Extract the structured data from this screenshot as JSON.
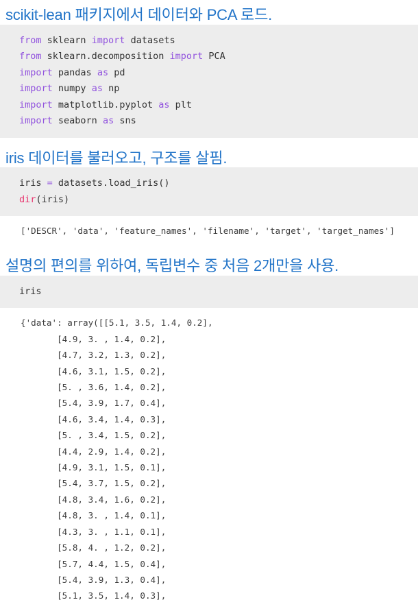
{
  "document": {
    "theme": {
      "page_background": "#ffffff",
      "heading_color": "#2274c8",
      "code_background": "#ededed",
      "code_text": "#333333",
      "keyword_color": "#9254de",
      "function_color": "#e8366f",
      "output_text": "#3c3c3c"
    },
    "cells": [
      {
        "type": "heading",
        "text": "scikit-lean 패키지에서 데이터와 PCA 로드."
      },
      {
        "type": "code",
        "lines": [
          [
            {
              "t": "from",
              "c": "kw"
            },
            {
              "t": " sklearn "
            },
            {
              "t": "import",
              "c": "kw"
            },
            {
              "t": " datasets"
            }
          ],
          [
            {
              "t": "from",
              "c": "kw"
            },
            {
              "t": " sklearn.decomposition "
            },
            {
              "t": "import",
              "c": "kw"
            },
            {
              "t": " PCA"
            }
          ],
          [
            {
              "t": "import",
              "c": "kw"
            },
            {
              "t": " pandas "
            },
            {
              "t": "as",
              "c": "kw"
            },
            {
              "t": " pd"
            }
          ],
          [
            {
              "t": "import",
              "c": "kw"
            },
            {
              "t": " numpy "
            },
            {
              "t": "as",
              "c": "kw"
            },
            {
              "t": " np"
            }
          ],
          [
            {
              "t": "import",
              "c": "kw"
            },
            {
              "t": " matplotlib.pyplot "
            },
            {
              "t": "as",
              "c": "kw"
            },
            {
              "t": " plt"
            }
          ],
          [
            {
              "t": "import",
              "c": "kw"
            },
            {
              "t": " seaborn "
            },
            {
              "t": "as",
              "c": "kw"
            },
            {
              "t": " sns"
            }
          ]
        ]
      },
      {
        "type": "heading",
        "text": "iris 데이터를 불러오고, 구조를 살핌."
      },
      {
        "type": "code",
        "lines": [
          [
            {
              "t": "iris "
            },
            {
              "t": "=",
              "c": "kw"
            },
            {
              "t": " datasets.load_iris()"
            }
          ],
          [
            {
              "t": "dir",
              "c": "fn"
            },
            {
              "t": "(iris)"
            }
          ]
        ]
      },
      {
        "type": "output",
        "text": "['DESCR', 'data', 'feature_names', 'filename', 'target', 'target_names']"
      },
      {
        "type": "heading",
        "text": "설명의 편의를 위하여, 독립변수 중 처음 2개만을 사용."
      },
      {
        "type": "code",
        "lines": [
          [
            {
              "t": "iris"
            }
          ]
        ]
      },
      {
        "type": "output",
        "text": "{'data': array([[5.1, 3.5, 1.4, 0.2],\n       [4.9, 3. , 1.4, 0.2],\n       [4.7, 3.2, 1.3, 0.2],\n       [4.6, 3.1, 1.5, 0.2],\n       [5. , 3.6, 1.4, 0.2],\n       [5.4, 3.9, 1.7, 0.4],\n       [4.6, 3.4, 1.4, 0.3],\n       [5. , 3.4, 1.5, 0.2],\n       [4.4, 2.9, 1.4, 0.2],\n       [4.9, 3.1, 1.5, 0.1],\n       [5.4, 3.7, 1.5, 0.2],\n       [4.8, 3.4, 1.6, 0.2],\n       [4.8, 3. , 1.4, 0.1],\n       [4.3, 3. , 1.1, 0.1],\n       [5.8, 4. , 1.2, 0.2],\n       [5.7, 4.4, 1.5, 0.4],\n       [5.4, 3.9, 1.3, 0.4],\n       [5.1, 3.5, 1.4, 0.3],"
      }
    ]
  }
}
